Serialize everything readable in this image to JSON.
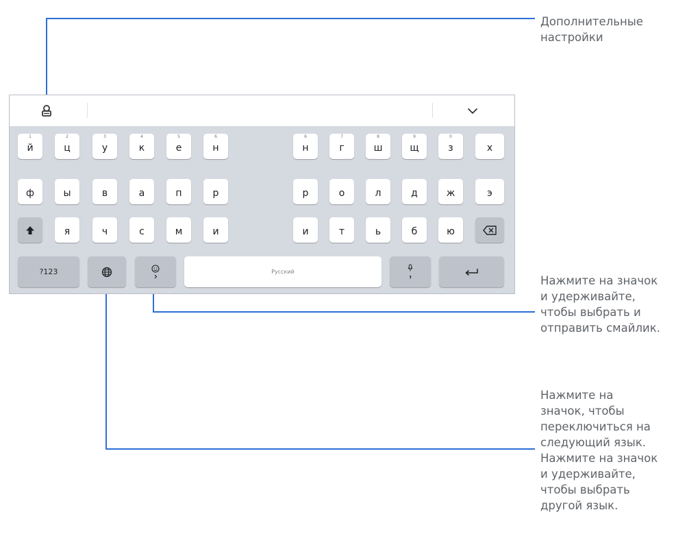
{
  "callouts": {
    "settings": "Дополнительные\nнастройки",
    "emoji": "Нажмите на значок\nи удерживайте,\nчтобы выбрать и\nотправить смайлик.",
    "language": "Нажмите на\nзначок, чтобы\nпереключиться на\nследующий язык.\nНажмите на значок\nи удерживайте,\nчтобы выбрать\nдругой язык."
  },
  "toolbar": {
    "icons": [
      "settings-icon",
      "collapse-keyboard-icon"
    ]
  },
  "rows": {
    "row1": [
      {
        "label": "й",
        "hint": "1"
      },
      {
        "label": "ц",
        "hint": "2"
      },
      {
        "label": "у",
        "hint": "3"
      },
      {
        "label": "к",
        "hint": "4"
      },
      {
        "label": "е",
        "hint": "5"
      },
      {
        "label": "н",
        "hint": "6"
      },
      {
        "label": "н",
        "hint": "6"
      },
      {
        "label": "г",
        "hint": "7"
      },
      {
        "label": "ш",
        "hint": "8"
      },
      {
        "label": "щ",
        "hint": "9"
      },
      {
        "label": "з",
        "hint": "0"
      },
      {
        "label": "х",
        "hint": ""
      }
    ],
    "row2": [
      {
        "label": "ф"
      },
      {
        "label": "ы"
      },
      {
        "label": "в"
      },
      {
        "label": "а"
      },
      {
        "label": "п"
      },
      {
        "label": "р"
      },
      {
        "label": "р"
      },
      {
        "label": "о"
      },
      {
        "label": "л"
      },
      {
        "label": "д"
      },
      {
        "label": "ж"
      },
      {
        "label": "э"
      }
    ],
    "row3": [
      {
        "label": "я"
      },
      {
        "label": "ч"
      },
      {
        "label": "с"
      },
      {
        "label": "м"
      },
      {
        "label": "и"
      },
      {
        "label": "и"
      },
      {
        "label": "т"
      },
      {
        "label": "ь"
      },
      {
        "label": "б"
      },
      {
        "label": "ю"
      }
    ]
  },
  "bottom": {
    "numbers": "?123",
    "space": "Русский",
    "icons": [
      "shift-icon",
      "backspace-icon",
      "globe-icon",
      "emoji-icon",
      "mic-comma-icon",
      "enter-icon"
    ]
  },
  "colors": {
    "accent": "#2a6fd6",
    "keyboard_bg": "#d5d9e0",
    "key": "#ffffff",
    "function_key": "#bec3cb",
    "callout_text": "#5f6368"
  }
}
